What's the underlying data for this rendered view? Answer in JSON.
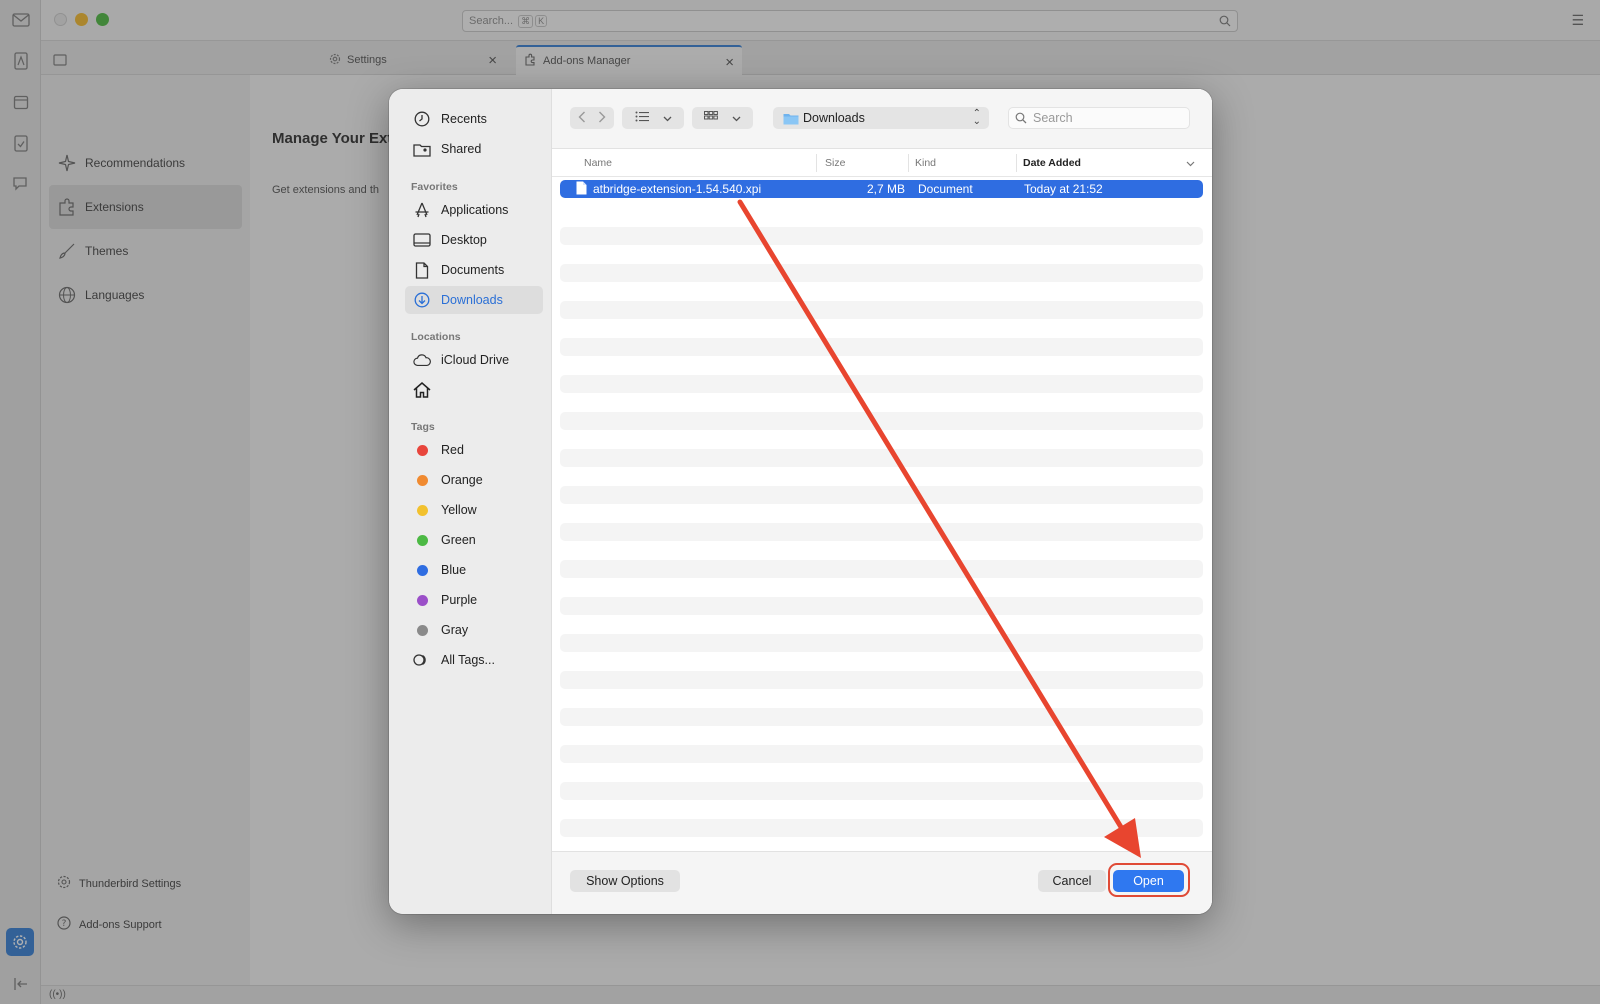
{
  "app": {
    "global_search_placeholder": "Search...",
    "global_search_shortcut": [
      "⌘",
      "K"
    ],
    "tabs": [
      {
        "label": "Settings"
      },
      {
        "label": "Add-ons Manager"
      }
    ],
    "categories": [
      {
        "label": "Recommendations"
      },
      {
        "label": "Extensions"
      },
      {
        "label": "Themes"
      },
      {
        "label": "Languages"
      }
    ],
    "footer_links": [
      {
        "label": "Thunderbird Settings"
      },
      {
        "label": "Add-ons Support"
      }
    ],
    "main_title": "Manage Your Ext",
    "main_subtitle": "Get extensions and th"
  },
  "dialog": {
    "sidebar": {
      "top": [
        {
          "label": "Recents",
          "icon": "clock-icon"
        },
        {
          "label": "Shared",
          "icon": "shared-folder-icon"
        }
      ],
      "favorites_heading": "Favorites",
      "favorites": [
        {
          "label": "Applications",
          "icon": "applications-icon"
        },
        {
          "label": "Desktop",
          "icon": "desktop-icon"
        },
        {
          "label": "Documents",
          "icon": "document-icon"
        },
        {
          "label": "Downloads",
          "icon": "downloads-icon",
          "active": true
        }
      ],
      "locations_heading": "Locations",
      "locations": [
        {
          "label": "iCloud Drive",
          "icon": "cloud-icon"
        },
        {
          "label": "",
          "icon": "home-icon"
        }
      ],
      "tags_heading": "Tags",
      "tags": [
        {
          "label": "Red",
          "color": "#e8453c"
        },
        {
          "label": "Orange",
          "color": "#f08a30"
        },
        {
          "label": "Yellow",
          "color": "#f2c12e"
        },
        {
          "label": "Green",
          "color": "#4cb944"
        },
        {
          "label": "Blue",
          "color": "#2f6de1"
        },
        {
          "label": "Purple",
          "color": "#9b4fc8"
        },
        {
          "label": "Gray",
          "color": "#8a8a8a"
        }
      ],
      "all_tags": "All Tags..."
    },
    "toolbar": {
      "current_folder": "Downloads",
      "search_placeholder": "Search"
    },
    "columns": {
      "name": "Name",
      "size": "Size",
      "kind": "Kind",
      "date_added": "Date Added"
    },
    "files": [
      {
        "name": "atbridge-extension-1.54.540.xpi",
        "size": "2,7 MB",
        "kind": "Document",
        "date_added": "Today at 21:52",
        "selected": true
      }
    ],
    "footer": {
      "show_options": "Show Options",
      "cancel": "Cancel",
      "open": "Open"
    },
    "annotation_color": "#e8452f"
  }
}
